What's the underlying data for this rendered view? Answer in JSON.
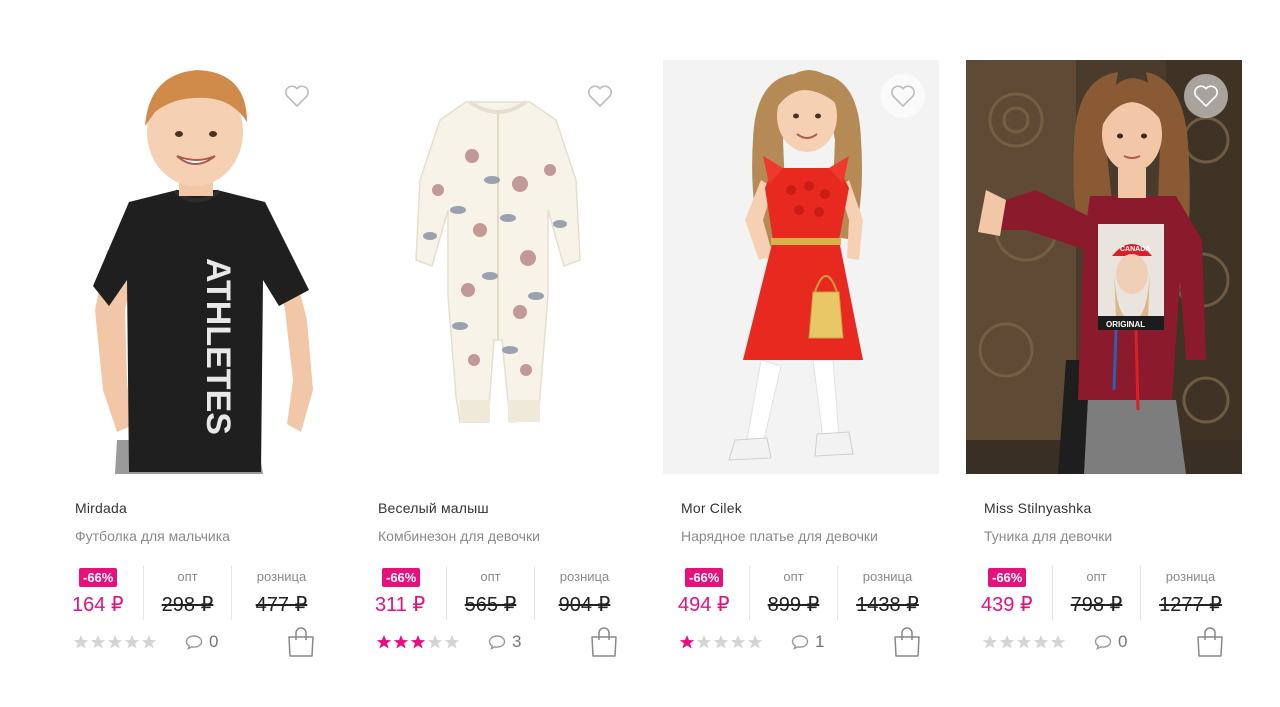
{
  "labels": {
    "opt": "опт",
    "retail": "розница"
  },
  "colors": {
    "accent": "#e8107c",
    "star_empty": "#d4d4d4"
  },
  "products": [
    {
      "brand": "Mirdada",
      "title": "Футболка для мальчика",
      "discount": "-66%",
      "sale_price": "164 ₽",
      "opt_price": "298 ₽",
      "retail_price": "477 ₽",
      "rating": 0,
      "comments": "0",
      "shirt_print": "ATHLETES",
      "favorite_icon": "heart-outline-icon",
      "cart_icon": "shopping-bag-icon"
    },
    {
      "brand": "Веселый малыш",
      "title": "Комбинезон для девочки",
      "discount": "-66%",
      "sale_price": "311 ₽",
      "opt_price": "565 ₽",
      "retail_price": "904 ₽",
      "rating": 3,
      "comments": "3",
      "favorite_icon": "heart-outline-icon",
      "cart_icon": "shopping-bag-icon"
    },
    {
      "brand": "Mor Cilek",
      "title": "Нарядное платье для девочки",
      "discount": "-66%",
      "sale_price": "494 ₽",
      "opt_price": "899 ₽",
      "retail_price": "1438 ₽",
      "rating": 1,
      "comments": "1",
      "favorite_icon": "heart-outline-icon",
      "cart_icon": "shopping-bag-icon"
    },
    {
      "brand": "Miss Stilnyashka",
      "title": "Туника для девочки",
      "discount": "-66%",
      "sale_price": "439 ₽",
      "opt_price": "798 ₽",
      "retail_price": "1277 ₽",
      "rating": 0,
      "comments": "0",
      "cap_print": "CANADA",
      "shirt_print": "ORIGINAL",
      "favorite_icon": "heart-outline-icon",
      "cart_icon": "shopping-bag-icon"
    }
  ]
}
